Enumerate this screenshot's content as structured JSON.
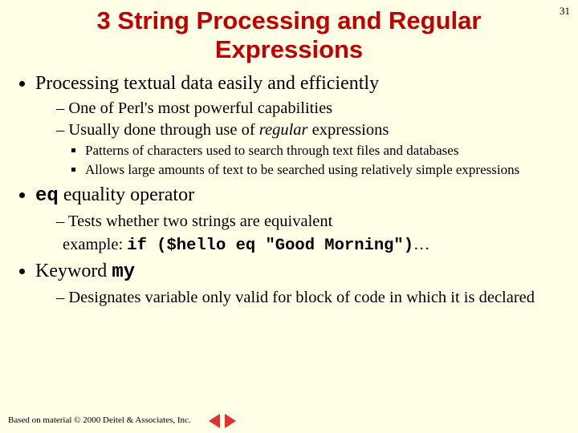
{
  "page_number": "31",
  "title": "3 String Processing and Regular Expressions",
  "bullets": {
    "b1": "Processing textual data easily and efficiently",
    "b1s": {
      "a": "One of Perl's most powerful capabilities",
      "b_pre": "Usually done through use of ",
      "b_ital": "regular",
      "b_post": " expressions",
      "b_sub": {
        "i": "Patterns of characters used to search through text files and databases",
        "ii": "Allows large amounts of text to be searched using relatively simple expressions"
      }
    },
    "b2_code": "eq",
    "b2_rest": " equality operator",
    "b2s": {
      "a": "Tests whether two strings are equivalent",
      "ex_label": "example: ",
      "ex_code": "if ($hello eq \"Good Morning\")",
      "ex_tail": "…"
    },
    "b3_pre": "Keyword ",
    "b3_code": "my",
    "b3s": {
      "a": "Designates variable only valid for block of code in which it is declared"
    }
  },
  "footer": "Based on material © 2000 Deitel & Associates, Inc."
}
